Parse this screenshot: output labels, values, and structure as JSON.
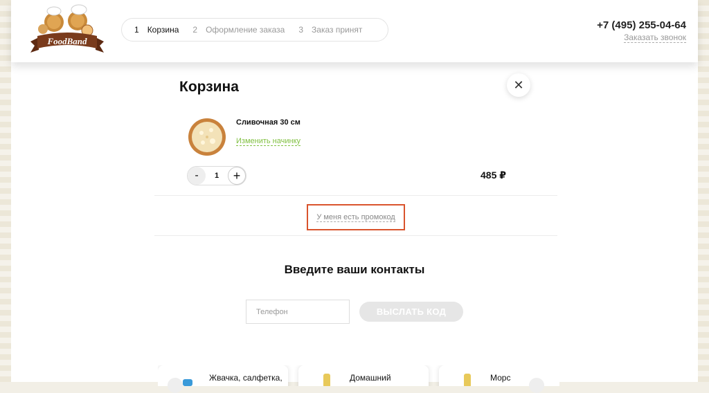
{
  "header": {
    "logo_text": "FoodBand",
    "steps": [
      {
        "num": "1",
        "label": "Корзина"
      },
      {
        "num": "2",
        "label": "Оформление заказа"
      },
      {
        "num": "3",
        "label": "Заказ принят"
      }
    ],
    "phone": "+7 (495) 255-04-64",
    "callback": "Заказать звонок"
  },
  "cart": {
    "title": "Корзина",
    "close_icon": "close-icon",
    "item": {
      "name": "Сливочная 30 см",
      "change_label": "Изменить начинку",
      "qty_minus": "-",
      "qty": "1",
      "qty_plus": "+",
      "price": "485 ₽"
    },
    "promo_label": "У меня есть промокод"
  },
  "contacts": {
    "title": "Введите ваши контакты",
    "phone_placeholder": "Телефон",
    "send_label": "ВЫСЛАТЬ КОД"
  },
  "recommendations": [
    {
      "name": "Жвачка, салфетка,"
    },
    {
      "name": "Домашний"
    },
    {
      "name": "Морс"
    }
  ],
  "colors": {
    "accent_green": "#7fbf3f",
    "highlight_border": "#d9532c",
    "logo_brown": "#7a3b1c"
  }
}
